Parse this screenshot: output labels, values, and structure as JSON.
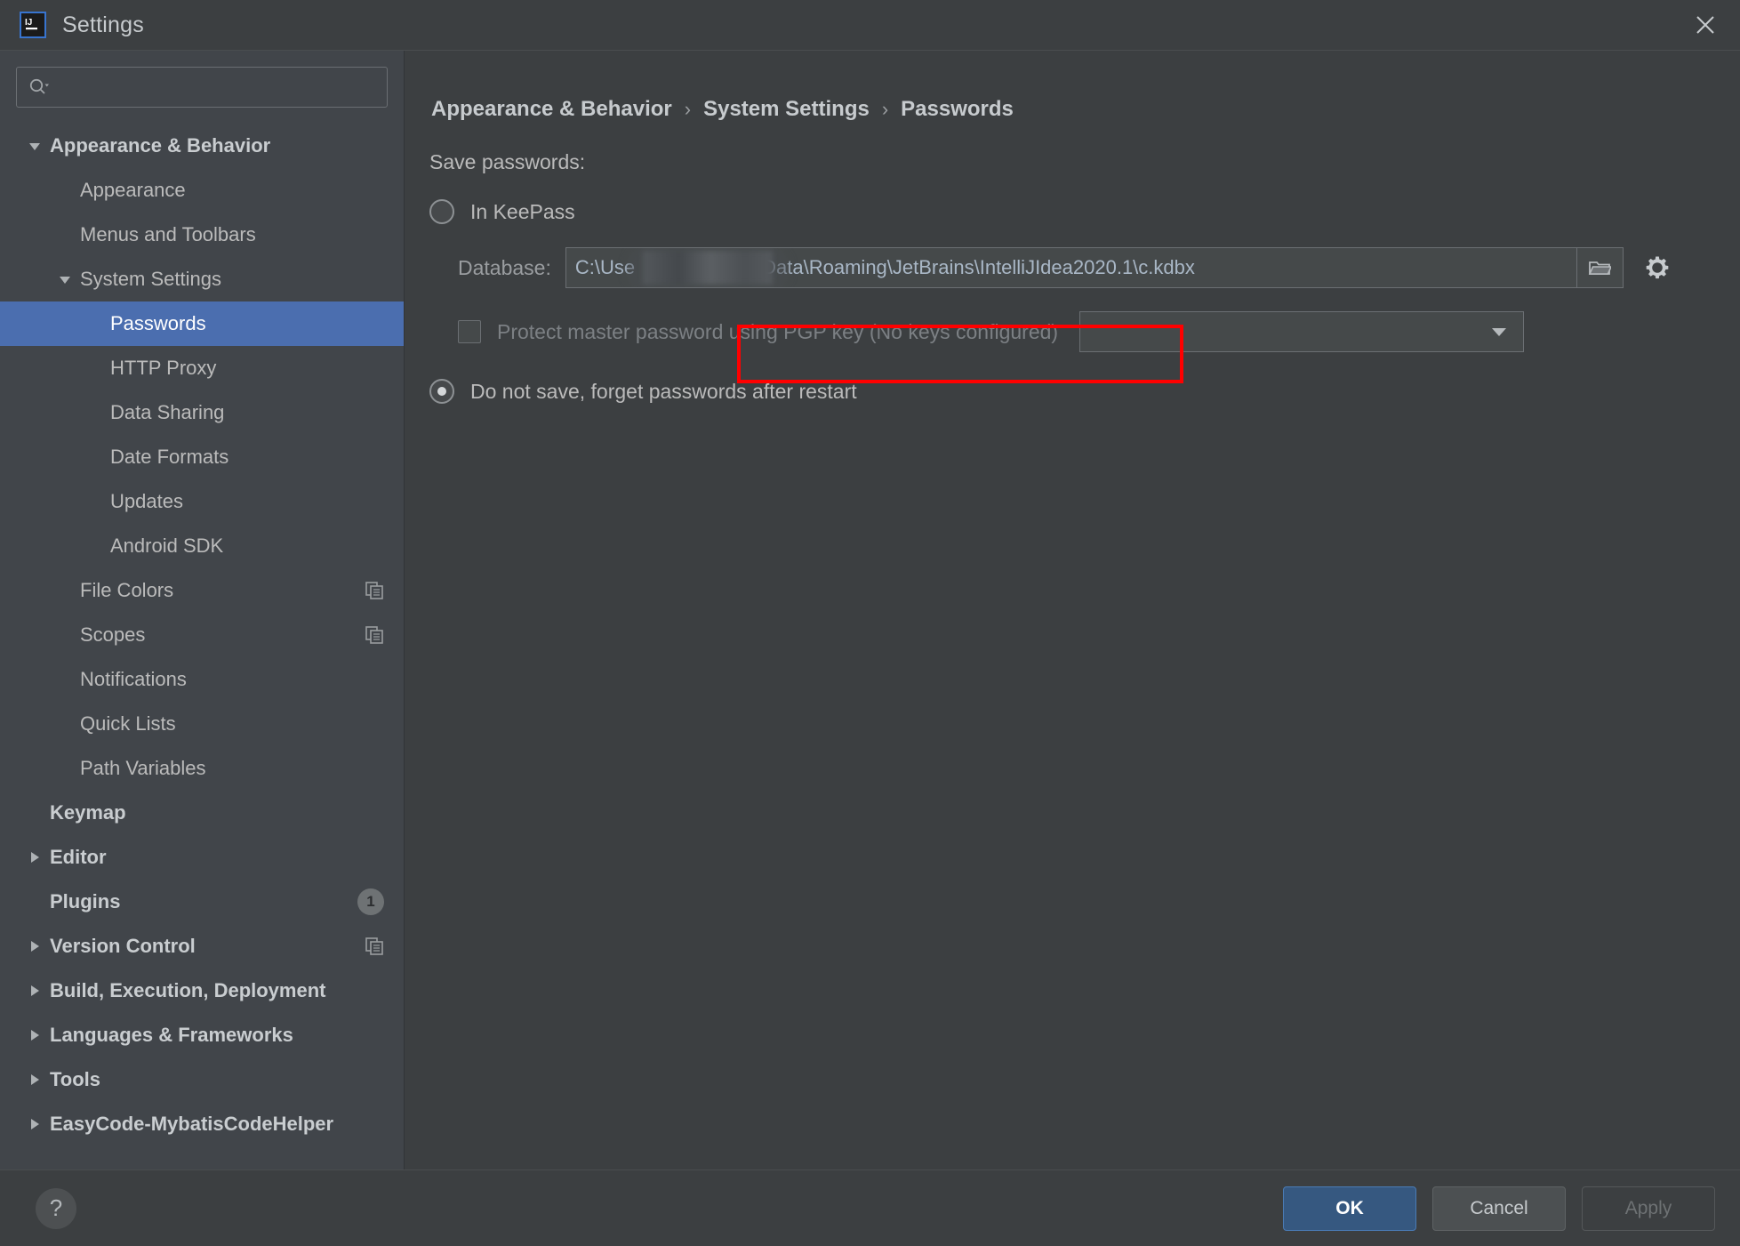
{
  "window": {
    "title": "Settings",
    "logo_icon": "intellij-idea-logo",
    "close_icon": "close-icon"
  },
  "search": {
    "value": "",
    "placeholder": "",
    "icon": "search-icon"
  },
  "sidebar": {
    "items": [
      {
        "label": "Appearance & Behavior",
        "level": 0,
        "bold": true,
        "expanded": true,
        "arrow": "down",
        "selected": false,
        "trail": ""
      },
      {
        "label": "Appearance",
        "level": 1,
        "bold": false,
        "expanded": false,
        "arrow": "none",
        "selected": false,
        "trail": ""
      },
      {
        "label": "Menus and Toolbars",
        "level": 1,
        "bold": false,
        "expanded": false,
        "arrow": "none",
        "selected": false,
        "trail": ""
      },
      {
        "label": "System Settings",
        "level": 1,
        "bold": false,
        "expanded": true,
        "arrow": "down",
        "selected": false,
        "trail": ""
      },
      {
        "label": "Passwords",
        "level": 2,
        "bold": false,
        "expanded": false,
        "arrow": "none",
        "selected": true,
        "trail": ""
      },
      {
        "label": "HTTP Proxy",
        "level": 2,
        "bold": false,
        "expanded": false,
        "arrow": "none",
        "selected": false,
        "trail": ""
      },
      {
        "label": "Data Sharing",
        "level": 2,
        "bold": false,
        "expanded": false,
        "arrow": "none",
        "selected": false,
        "trail": ""
      },
      {
        "label": "Date Formats",
        "level": 2,
        "bold": false,
        "expanded": false,
        "arrow": "none",
        "selected": false,
        "trail": ""
      },
      {
        "label": "Updates",
        "level": 2,
        "bold": false,
        "expanded": false,
        "arrow": "none",
        "selected": false,
        "trail": ""
      },
      {
        "label": "Android SDK",
        "level": 2,
        "bold": false,
        "expanded": false,
        "arrow": "none",
        "selected": false,
        "trail": ""
      },
      {
        "label": "File Colors",
        "level": 1,
        "bold": false,
        "expanded": false,
        "arrow": "none",
        "selected": false,
        "trail": "copy"
      },
      {
        "label": "Scopes",
        "level": 1,
        "bold": false,
        "expanded": false,
        "arrow": "none",
        "selected": false,
        "trail": "copy"
      },
      {
        "label": "Notifications",
        "level": 1,
        "bold": false,
        "expanded": false,
        "arrow": "none",
        "selected": false,
        "trail": ""
      },
      {
        "label": "Quick Lists",
        "level": 1,
        "bold": false,
        "expanded": false,
        "arrow": "none",
        "selected": false,
        "trail": ""
      },
      {
        "label": "Path Variables",
        "level": 1,
        "bold": false,
        "expanded": false,
        "arrow": "none",
        "selected": false,
        "trail": ""
      },
      {
        "label": "Keymap",
        "level": 0,
        "bold": true,
        "expanded": false,
        "arrow": "none",
        "selected": false,
        "trail": ""
      },
      {
        "label": "Editor",
        "level": 0,
        "bold": true,
        "expanded": false,
        "arrow": "right",
        "selected": false,
        "trail": ""
      },
      {
        "label": "Plugins",
        "level": 0,
        "bold": true,
        "expanded": false,
        "arrow": "none",
        "selected": false,
        "trail": "badge",
        "badge": "1"
      },
      {
        "label": "Version Control",
        "level": 0,
        "bold": true,
        "expanded": false,
        "arrow": "right",
        "selected": false,
        "trail": "copy"
      },
      {
        "label": "Build, Execution, Deployment",
        "level": 0,
        "bold": true,
        "expanded": false,
        "arrow": "right",
        "selected": false,
        "trail": ""
      },
      {
        "label": "Languages & Frameworks",
        "level": 0,
        "bold": true,
        "expanded": false,
        "arrow": "right",
        "selected": false,
        "trail": ""
      },
      {
        "label": "Tools",
        "level": 0,
        "bold": true,
        "expanded": false,
        "arrow": "right",
        "selected": false,
        "trail": ""
      },
      {
        "label": "EasyCode-MybatisCodeHelper",
        "level": 0,
        "bold": true,
        "expanded": false,
        "arrow": "right",
        "selected": false,
        "trail": ""
      }
    ]
  },
  "breadcrumb": {
    "items": [
      "Appearance & Behavior",
      "System Settings",
      "Passwords"
    ],
    "separator": "›"
  },
  "main": {
    "section_label": "Save passwords:",
    "option_keepass": {
      "label": "In KeePass",
      "selected": false
    },
    "database": {
      "label": "Database:",
      "value_prefix": "C:\\Use",
      "value_suffix": "1\\AppData\\Roaming\\JetBrains\\IntelliJIdea2020.1\\c.kdbx",
      "redacted": true,
      "browse_icon": "folder-icon",
      "gear_icon": "gear-icon"
    },
    "pgp": {
      "label": "Protect master password using PGP key (No keys configured)",
      "checked": false,
      "disabled": true,
      "select_value": "",
      "select_icon": "chevron-down-icon"
    },
    "option_forget": {
      "label": "Do not save, forget passwords after restart",
      "selected": true,
      "annotated": true,
      "annotation_color": "#ff0000"
    }
  },
  "footer": {
    "help_label": "?",
    "ok_label": "OK",
    "cancel_label": "Cancel",
    "apply_label": "Apply",
    "apply_disabled": true
  },
  "colors": {
    "accent": "#4b6eaf",
    "primary_button": "#365880",
    "annotation": "#ff0000",
    "background": "#3c3f41",
    "sidebar": "#41454a",
    "text": "#bbbbbb"
  }
}
